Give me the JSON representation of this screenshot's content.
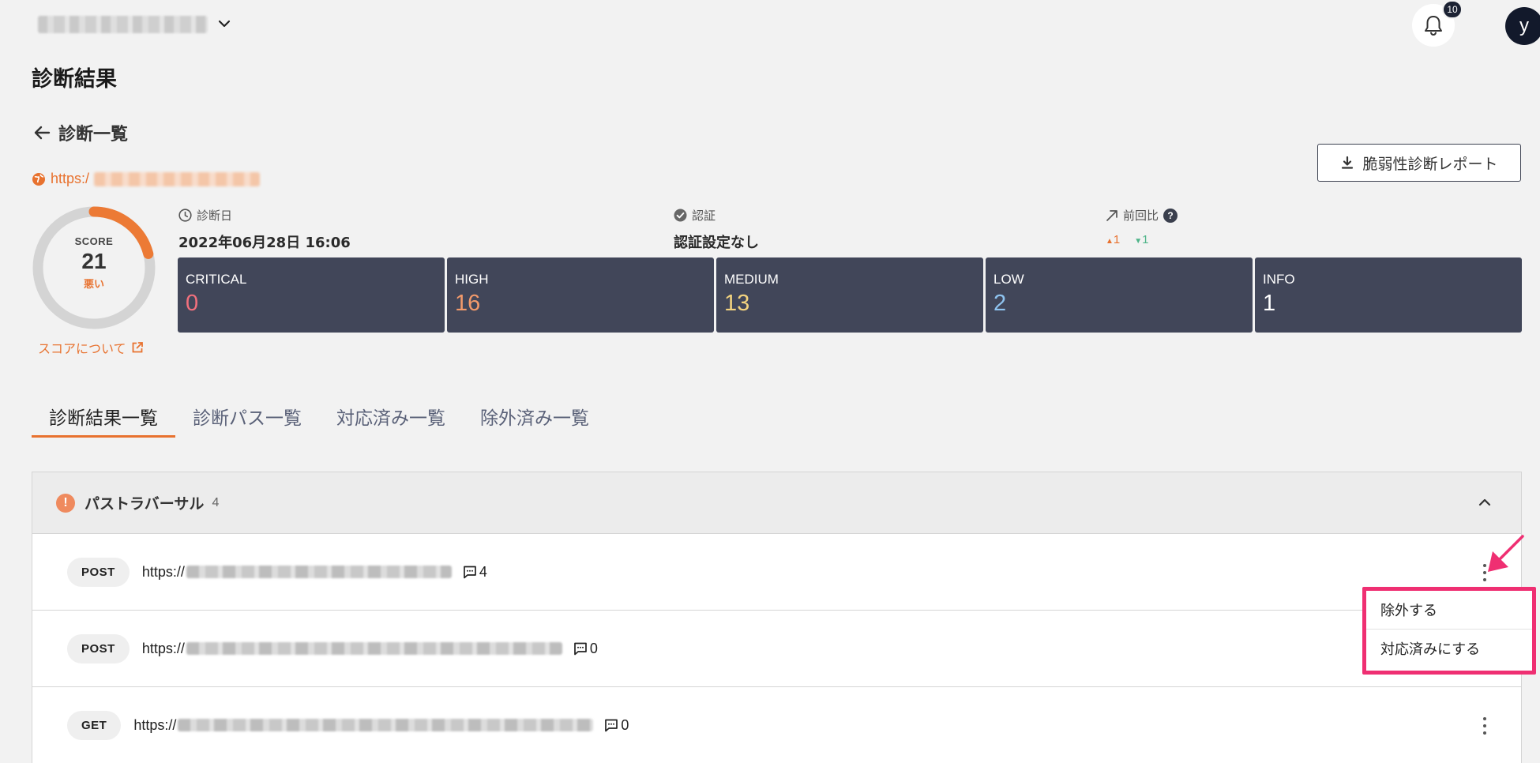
{
  "header": {
    "notification_count": "10",
    "avatar_initial": "y"
  },
  "page": {
    "title": "診断結果",
    "back_label": "診断一覧",
    "target_url_prefix": "https:/",
    "report_button": "脆弱性診断レポート"
  },
  "score": {
    "label": "SCORE",
    "value": "21",
    "level": "悪い",
    "about_link": "スコアについて",
    "ring_fraction": 0.21
  },
  "meta": {
    "date_label": "診断日",
    "date_value": "2022年06月28日 16:06",
    "auth_label": "認証",
    "auth_value": "認証設定なし",
    "compare_label": "前回比",
    "compare_help": "?",
    "compare_up": "1",
    "compare_down": "1"
  },
  "severity": [
    {
      "name": "CRITICAL",
      "count": "0",
      "color": "#f2707d"
    },
    {
      "name": "HIGH",
      "count": "16",
      "color": "#f39a6b"
    },
    {
      "name": "MEDIUM",
      "count": "13",
      "color": "#f3d37f"
    },
    {
      "name": "LOW",
      "count": "2",
      "color": "#8fc4f0"
    },
    {
      "name": "INFO",
      "count": "1",
      "color": "#ffffff"
    }
  ],
  "tabs": [
    {
      "label": "診断結果一覧",
      "active": true
    },
    {
      "label": "診断パス一覧",
      "active": false
    },
    {
      "label": "対応済み一覧",
      "active": false
    },
    {
      "label": "除外済み一覧",
      "active": false
    }
  ],
  "group": {
    "title": "パストラバーサル",
    "count": "4",
    "rows": [
      {
        "method": "POST",
        "url_prefix": "https://",
        "comments": "4"
      },
      {
        "method": "POST",
        "url_prefix": "https://",
        "comments": "0"
      },
      {
        "method": "GET",
        "url_prefix": "https://",
        "comments": "0"
      }
    ]
  },
  "menu": {
    "exclude": "除外する",
    "mark_resolved": "対応済みにする"
  },
  "colors": {
    "accent": "#e8722f",
    "card_bg": "#414659",
    "highlight": "#ef2f72"
  }
}
